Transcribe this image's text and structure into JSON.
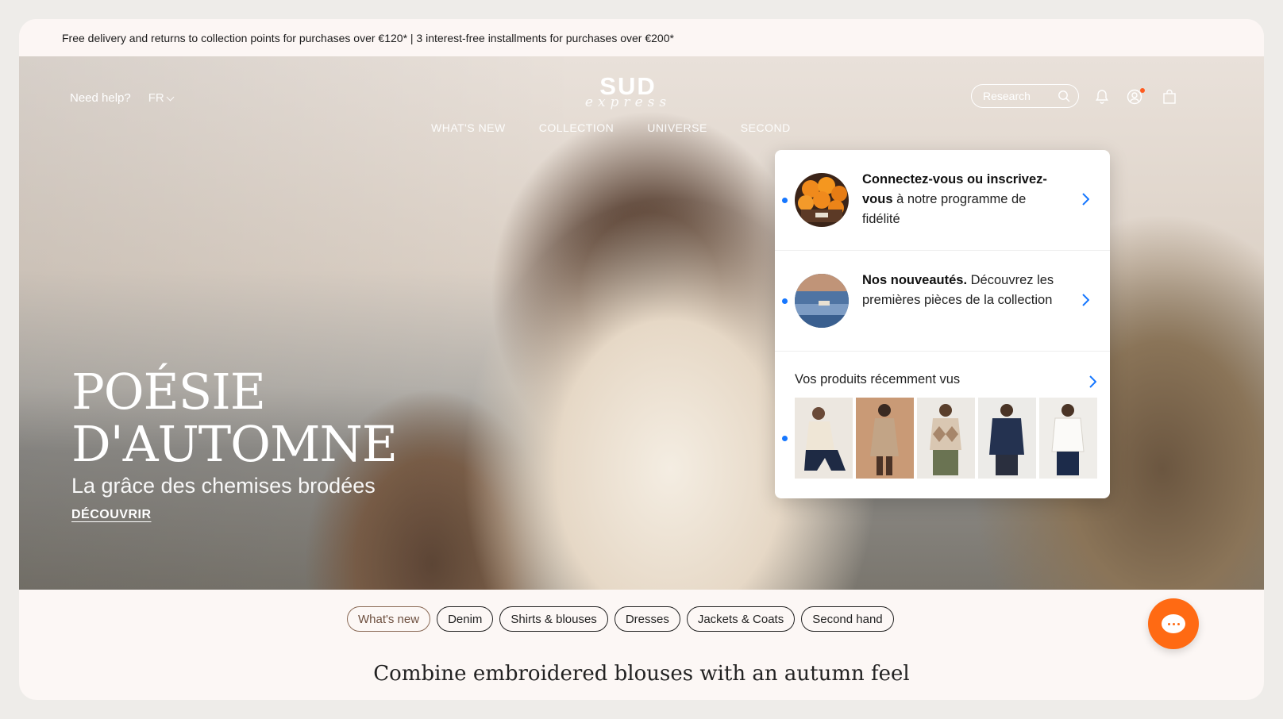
{
  "promo": {
    "text": "Free delivery and returns to collection points for purchases over €120* | 3 interest-free installments for purchases over €200*"
  },
  "header": {
    "help_label": "Need help?",
    "language": "FR",
    "logo_main": "SUD",
    "logo_sub": "express",
    "search_placeholder": "Research",
    "nav": [
      "WHAT'S NEW",
      "COLLECTION",
      "UNIVERSE",
      "SECOND"
    ]
  },
  "hero": {
    "title_line1": "POÉSIE",
    "title_line2": "D'AUTOMNE",
    "subtitle": "La grâce des chemises brodées",
    "cta": "DÉCOUVRIR"
  },
  "popup": {
    "items": [
      {
        "bold": "Connectez-vous ou inscrivez-vous",
        "text": " à notre programme de fidélité"
      },
      {
        "bold": "Nos nouveautés.",
        "text": " Découvrez les premières pièces de la collection"
      }
    ],
    "recent_title": "Vos produits récemment vus"
  },
  "categories": [
    {
      "label": "What's new",
      "active": true
    },
    {
      "label": "Denim",
      "active": false
    },
    {
      "label": "Shirts & blouses",
      "active": false
    },
    {
      "label": "Dresses",
      "active": false
    },
    {
      "label": "Jackets & Coats",
      "active": false
    },
    {
      "label": "Second hand",
      "active": false
    }
  ],
  "section": {
    "heading": "Combine embroidered blouses with an autumn feel"
  },
  "colors": {
    "accent": "#ff6a13",
    "link_blue": "#1677ff"
  }
}
